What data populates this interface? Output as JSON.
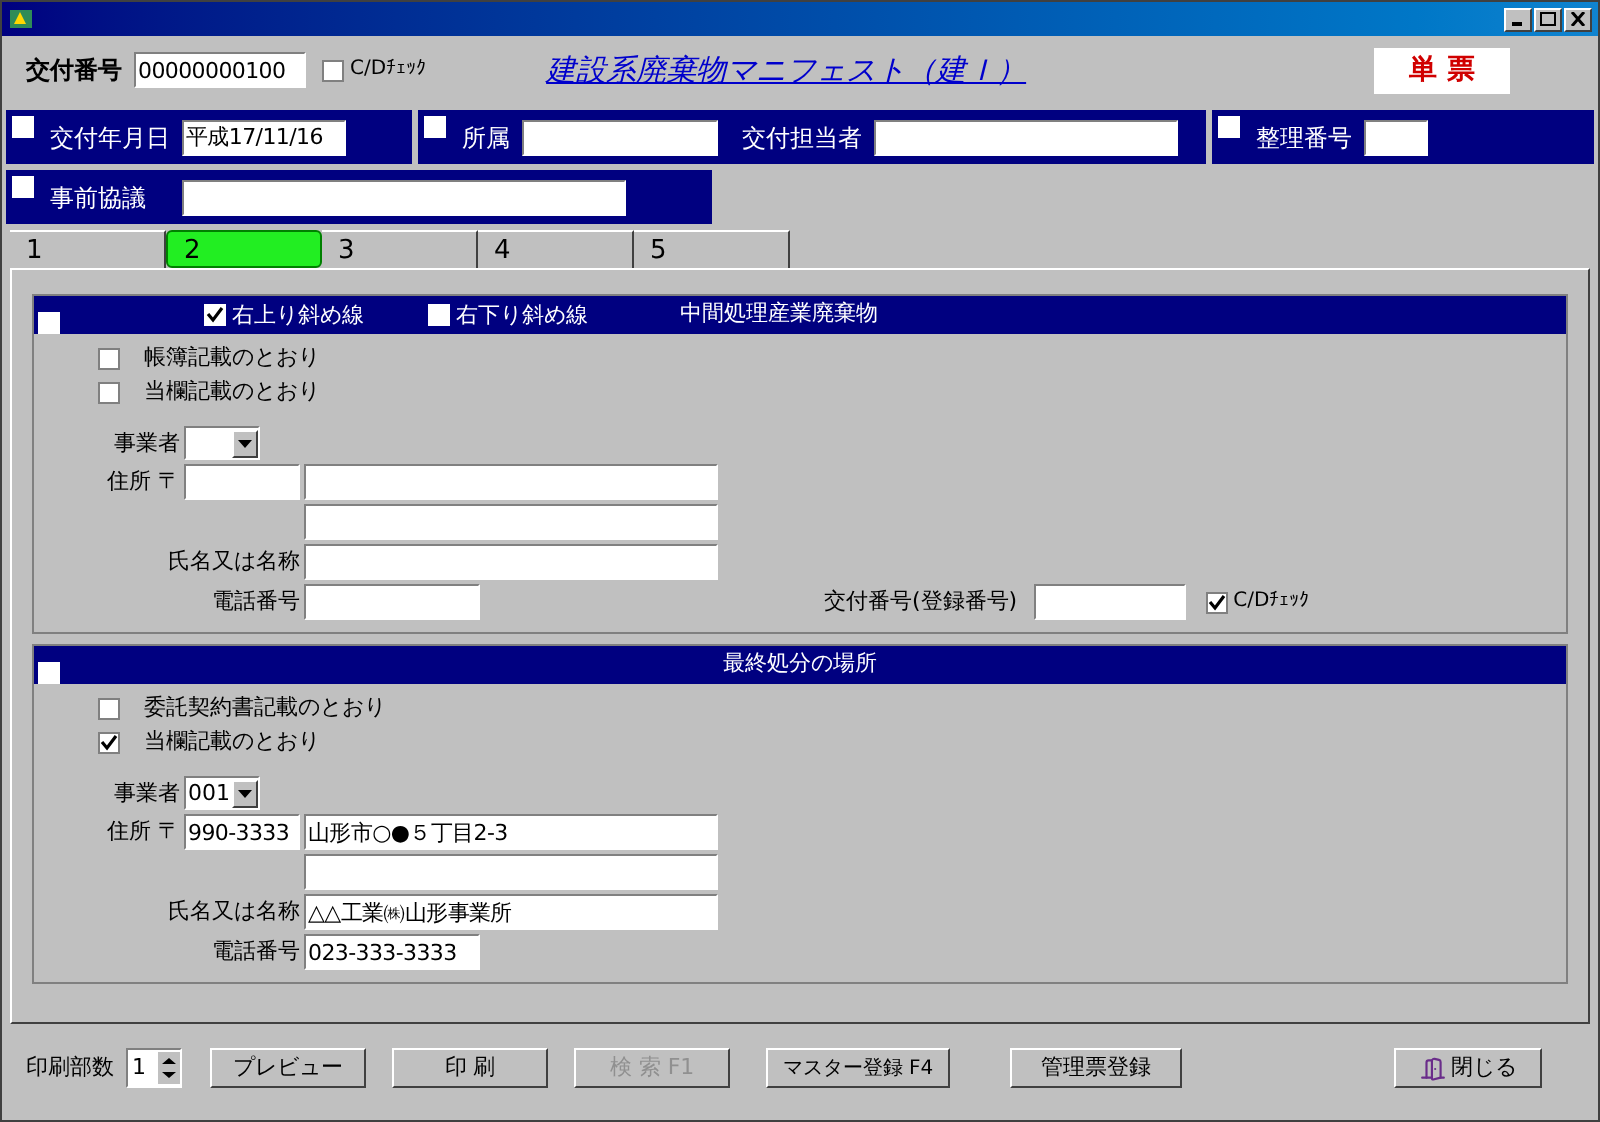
{
  "header": {
    "issue_number_label": "交付番号",
    "issue_number": "00000000100",
    "cd_check": {
      "label": "C/Dﾁｪｯｸ",
      "checked": false
    },
    "form_title": "建設系廃棄物マニフェスト（建Ｉ）",
    "form_type": "単 票"
  },
  "info_rows": [
    [
      {
        "checked": false,
        "fields": [
          {
            "label": "交付年月日",
            "value": "平成17/11/16"
          }
        ]
      },
      {
        "checked": false,
        "fields": [
          {
            "label": "所属"
          },
          {
            "label": "交付担当者"
          }
        ]
      },
      {
        "checked": false,
        "fields": [
          {
            "label": "整理番号"
          }
        ]
      }
    ],
    [
      {
        "checked": false,
        "fields": [
          {
            "label": "事前協議"
          }
        ]
      }
    ]
  ],
  "tabs": [
    {
      "label": "1",
      "selected": false
    },
    {
      "label": "2",
      "selected": true
    },
    {
      "label": "3",
      "selected": false
    },
    {
      "label": "4",
      "selected": false
    },
    {
      "label": "5",
      "selected": false
    }
  ],
  "sections": [
    {
      "checked": false,
      "options": [
        {
          "label": "右上り斜め線",
          "checked": true
        },
        {
          "label": "右下り斜め線",
          "checked": false
        }
      ],
      "title": "中間処理産業廃棄物",
      "choices": [
        {
          "label": "帳簿記載のとおり",
          "checked": false
        },
        {
          "label": "当欄記載のとおり",
          "checked": false
        }
      ],
      "company_label": "事業者",
      "address_label": "住所 〒",
      "name_label": "氏名又は名称",
      "phone_label": "電話番号",
      "issue": {
        "label": "交付番号(登録番号)",
        "cd_check": {
          "label": "C/Dﾁｪｯｸ",
          "checked": true
        }
      }
    },
    {
      "checked": false,
      "title": "最終処分の場所",
      "choices": [
        {
          "label": "委託契約書記載のとおり",
          "checked": false
        },
        {
          "label": "当欄記載のとおり",
          "checked": true
        }
      ],
      "company_label": "事業者",
      "company": "001",
      "address_label": "住所 〒",
      "postal": "990-3333",
      "address1": "山形市○●５丁目2-3",
      "name_label": "氏名又は名称",
      "name": "△△工業㈱山形事業所",
      "phone_label": "電話番号",
      "phone": "023-333-3333"
    }
  ],
  "footer": {
    "copies_label": "印刷部数",
    "copies": "1",
    "buttons": [
      {
        "label": "プレビュー",
        "disabled": false
      },
      {
        "label": "印 刷",
        "disabled": false
      },
      {
        "label": "検 索 F1",
        "disabled": true
      },
      {
        "label": "マスター登録 F4",
        "disabled": false
      },
      {
        "label": "管理票登録",
        "disabled": false
      }
    ],
    "close": "閉じる"
  }
}
